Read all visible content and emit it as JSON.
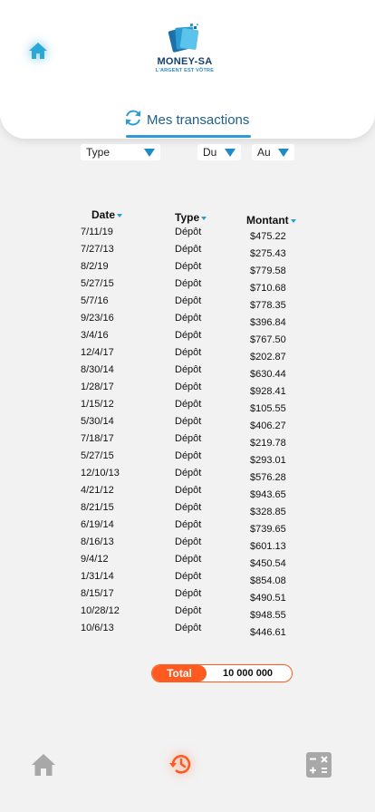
{
  "brand": {
    "name": "MONEY-SA",
    "tagline": "L'ARGENT EST VÔTRE"
  },
  "tab": {
    "label": "Mes transactions"
  },
  "filters": {
    "type": "Type",
    "from": "Du",
    "to": "Au"
  },
  "table": {
    "headers": {
      "date": "Date",
      "type": "Type",
      "amount": "Montant"
    },
    "rows": [
      {
        "date": "7/11/19",
        "type": "Dépôt",
        "amount": "$475.22"
      },
      {
        "date": "7/27/13",
        "type": "Dépôt",
        "amount": "$275.43"
      },
      {
        "date": "8/2/19",
        "type": "Dépôt",
        "amount": "$779.58"
      },
      {
        "date": "5/27/15",
        "type": "Dépôt",
        "amount": "$710.68"
      },
      {
        "date": "5/7/16",
        "type": "Dépôt",
        "amount": "$778.35"
      },
      {
        "date": "9/23/16",
        "type": "Dépôt",
        "amount": "$396.84"
      },
      {
        "date": "3/4/16",
        "type": "Dépôt",
        "amount": "$767.50"
      },
      {
        "date": "12/4/17",
        "type": "Dépôt",
        "amount": "$202.87"
      },
      {
        "date": "8/30/14",
        "type": "Dépôt",
        "amount": "$630.44"
      },
      {
        "date": "1/28/17",
        "type": "Dépôt",
        "amount": "$928.41"
      },
      {
        "date": "1/15/12",
        "type": "Dépôt",
        "amount": "$105.55"
      },
      {
        "date": "5/30/14",
        "type": "Dépôt",
        "amount": "$406.27"
      },
      {
        "date": "7/18/17",
        "type": "Dépôt",
        "amount": "$219.78"
      },
      {
        "date": "5/27/15",
        "type": "Dépôt",
        "amount": "$293.01"
      },
      {
        "date": "12/10/13",
        "type": "Dépôt",
        "amount": "$576.28"
      },
      {
        "date": "4/21/12",
        "type": "Dépôt",
        "amount": "$943.65"
      },
      {
        "date": "8/21/15",
        "type": "Dépôt",
        "amount": "$328.85"
      },
      {
        "date": "6/19/14",
        "type": "Dépôt",
        "amount": "$739.65"
      },
      {
        "date": "8/16/13",
        "type": "Dépôt",
        "amount": "$601.13"
      },
      {
        "date": "9/4/12",
        "type": "Dépôt",
        "amount": "$450.54"
      },
      {
        "date": "1/31/14",
        "type": "Dépôt",
        "amount": "$854.08"
      },
      {
        "date": "8/15/17",
        "type": "Dépôt",
        "amount": "$490.51"
      },
      {
        "date": "10/28/12",
        "type": "Dépôt",
        "amount": "$948.55"
      },
      {
        "date": "10/6/13",
        "type": "Dépôt",
        "amount": "$446.61"
      }
    ]
  },
  "total": {
    "label": "Total",
    "value": "10 000 000"
  },
  "icons": {
    "home_top": "home-icon",
    "refresh": "refresh-icon",
    "nav_home": "home-icon",
    "nav_history": "history-icon",
    "nav_calculator": "calculator-icon"
  },
  "colors": {
    "accent": "#2a9bd3",
    "brand_dark": "#15406e",
    "orange": "#ff5a1f",
    "nav_gray": "#a8a8a8"
  }
}
